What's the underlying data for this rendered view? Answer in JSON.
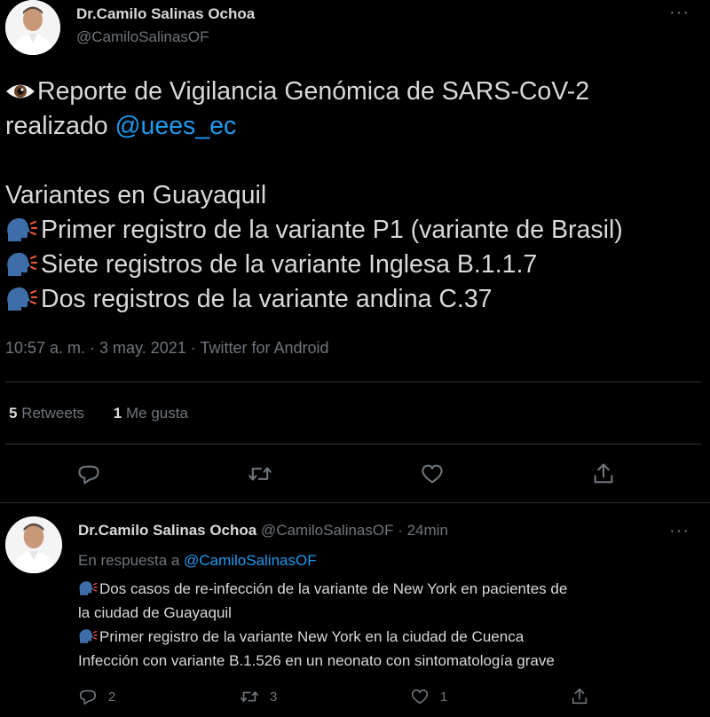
{
  "colors": {
    "background": "#000000",
    "text": "#d9d9d9",
    "muted": "#6e767d",
    "link": "#1d9bf0",
    "divider": "#2f3336"
  },
  "main_tweet": {
    "author_name": "Dr.Camilo Salinas Ochoa",
    "author_handle": "@CamiloSalinasOF",
    "body": {
      "line1_emoji": "eye-icon",
      "line1": "Reporte de Vigilancia Genómica de SARS-CoV-2",
      "line2": "realizado ",
      "line2_mention": "@uees_ec",
      "line3": "Variantes en Guayaquil",
      "items": [
        "Primer registro de la variante P1 (variante de Brasil)",
        "Siete registros de la variante Inglesa B.1.1.7",
        "Dos registros de la variante andina C.37"
      ],
      "item_icon": "speaking-head-icon"
    },
    "timestamp": "10:57 a. m. · 3 may. 2021 · Twitter for Android",
    "stats": {
      "retweets_count": "5",
      "retweets_label": " Retweets",
      "likes_count": "1",
      "likes_label": " Me gusta"
    },
    "actions": [
      "reply-icon",
      "retweet-icon",
      "like-icon",
      "share-icon"
    ]
  },
  "reply_tweet": {
    "author_name": "Dr.Camilo Salinas Ochoa",
    "author_handle": " @CamiloSalinasOF · 24min",
    "reply_to_label": "En respuesta a ",
    "reply_to_mention": "@CamiloSalinasOF",
    "lines": [
      "Dos casos de re-infección de la variante de New York en pacientes de",
      "la ciudad de Guayaquil",
      "Primer registro de la variante New York en la ciudad de Cuenca",
      "Infección con variante B.1.526 en un neonato con sintomatología grave"
    ],
    "reply_count": "2",
    "retweet_count": "3",
    "like_count": "1"
  }
}
